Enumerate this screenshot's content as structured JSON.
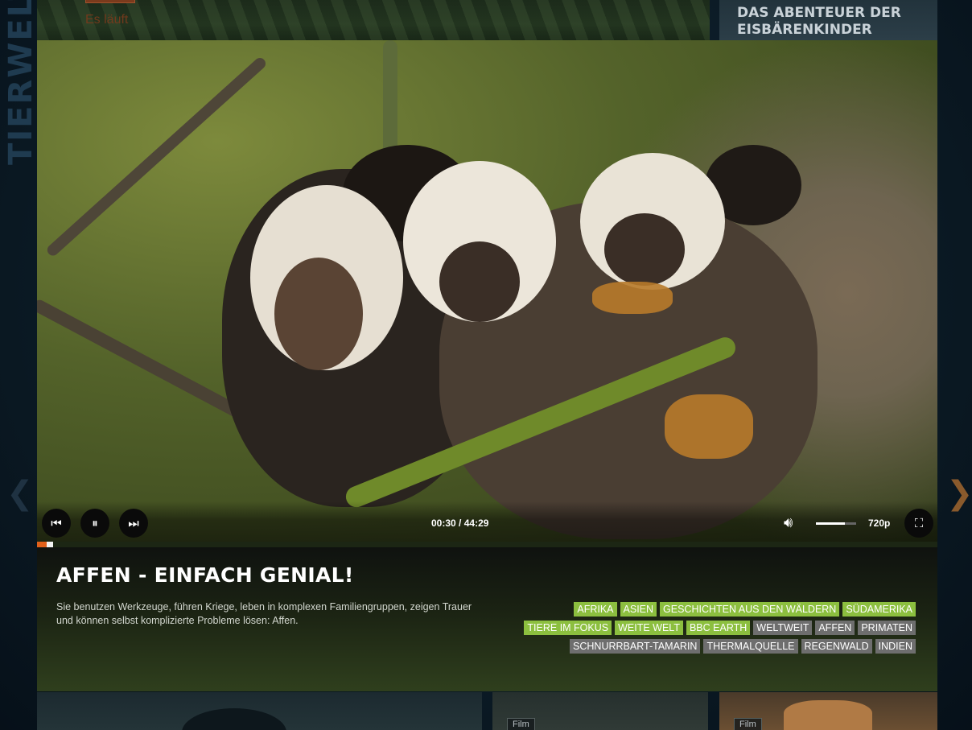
{
  "section_title": "TIERWELT",
  "top_tiles": {
    "left_status": "Es läuft",
    "right_title": "DAS ABENTEUER DER EISBÄRENKINDER"
  },
  "bottom_tiles": {
    "film_badge_1": "Film",
    "film_badge_2": "Film"
  },
  "player": {
    "current_time": "00:30",
    "separator": "/",
    "duration": "44:29",
    "progress_fraction": 0.011,
    "volume_fraction": 0.72,
    "quality": "720p",
    "icons": {
      "prev": "skip-previous-icon",
      "pause": "pause-icon",
      "next": "skip-next-icon",
      "volume": "volume-icon",
      "fullscreen": "fullscreen-icon"
    }
  },
  "video": {
    "title": "AFFEN - EINFACH GENIAL!",
    "description": "Sie benutzen Werkzeuge, führen Kriege, leben in komplexen Familiengruppen, zeigen Trauer und können selbst komplizierte Probleme lösen: Affen."
  },
  "tags": [
    [
      {
        "label": "AFRIKA",
        "kind": "green"
      },
      {
        "label": "ASIEN",
        "kind": "green"
      },
      {
        "label": "GESCHICHTEN AUS DEN WÄLDERN",
        "kind": "green"
      },
      {
        "label": "SÜDAMERIKA",
        "kind": "green"
      }
    ],
    [
      {
        "label": "TIERE IM FOKUS",
        "kind": "green"
      },
      {
        "label": "WEITE WELT",
        "kind": "green"
      },
      {
        "label": "BBC EARTH",
        "kind": "green"
      },
      {
        "label": "WELTWEIT",
        "kind": "gray"
      },
      {
        "label": "AFFEN",
        "kind": "gray"
      },
      {
        "label": "PRIMATEN",
        "kind": "gray"
      }
    ],
    [
      {
        "label": "SCHNURRBART-TAMARIN",
        "kind": "gray"
      },
      {
        "label": "THERMALQUELLE",
        "kind": "gray"
      },
      {
        "label": "REGENWALD",
        "kind": "gray"
      },
      {
        "label": "INDIEN",
        "kind": "gray"
      }
    ]
  ],
  "colors": {
    "tag_green": "#8cbf3f",
    "tag_gray": "#6e6e6e",
    "progress_accent": "#e1601a"
  }
}
